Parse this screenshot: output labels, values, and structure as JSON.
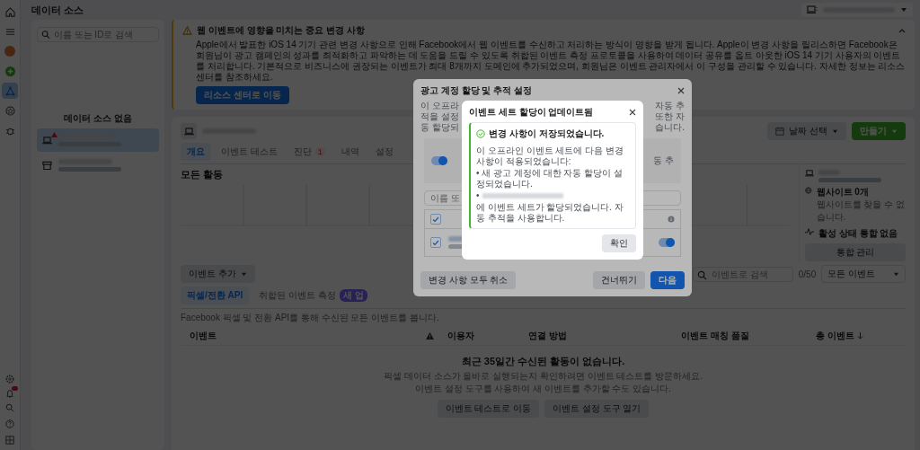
{
  "header": {
    "title": "데이터 소스"
  },
  "rail": {
    "items": [
      {
        "kind": "home",
        "selected": false
      },
      {
        "kind": "menu",
        "selected": false
      },
      {
        "kind": "avatar",
        "selected": false
      },
      {
        "kind": "add",
        "selected": false
      },
      {
        "kind": "network",
        "selected": true
      },
      {
        "kind": "star",
        "selected": false
      },
      {
        "kind": "bug",
        "selected": false
      }
    ],
    "bell_badge": true
  },
  "sidebar": {
    "search_placeholder": "이름 또는 ID로 검색",
    "empty_label": "데이터 소스 없음",
    "items": [
      {
        "kind": "laptop",
        "selected": true,
        "warning": true
      },
      {
        "kind": "store",
        "selected": false,
        "warning": false
      }
    ]
  },
  "banner": {
    "title": "웹 이벤트에 영향을 미치는 중요 변경 사항",
    "body": "Apple에서 발표한 iOS 14 기기 관련 변경 사항으로 인해 Facebook에서 웹 이벤트를 수신하고 처리하는 방식이 영향을 받게 됩니다. Apple이 변경 사항을 릴리스하면 Facebook은 회원님이 광고 캠페인의 성과를 최적화하고 파악하는 데 도움을 드릴 수 있도록 취합된 이벤트 측정 프로토콜을 사용하여 데이터 공유를 옵트 아웃한 iOS 14 기기 사용자의 이벤트를 처리합니다. 기본적으로 비즈니스에 권장되는 이벤트가 최대 8개까지 도메인에 추가되었으며, 회원님은 이벤트 관리자에서 이 구성을 관리할 수 있습니다. 자세한 정보는 리소스 센터를 참조하세요.",
    "button": "리소스 센터로 이동"
  },
  "card": {
    "tabs": [
      {
        "label": "개요",
        "selected": true
      },
      {
        "label": "이벤트 테스트",
        "selected": false
      },
      {
        "label": "진단",
        "selected": false,
        "badge": "1"
      },
      {
        "label": "내역",
        "selected": false
      },
      {
        "label": "설정",
        "selected": false
      }
    ],
    "date_button": "날짜 선택",
    "create_button": "만들기",
    "section_title": "모든 활동",
    "side": {
      "websites_title": "웹사이트 0개",
      "websites_text": "웹사이트를 찾을 수 없습니다.",
      "integration": "활성 상태 통합 없음",
      "manage_button": "통합 관리"
    },
    "add_event_button": "이벤트 추가",
    "event_search": {
      "placeholder": "이벤트로 검색",
      "count": "0/50"
    },
    "event_filter": "모든 이벤트",
    "subtabs": [
      {
        "label": "픽셀/전환 API",
        "selected": true
      },
      {
        "label": "취합된 이벤트 측정",
        "selected": false,
        "badge": "새 업"
      }
    ],
    "description": "Facebook 픽셀 및 전환 API를 통해 수신된 모든 이벤트를 봅니다.",
    "columns": [
      {
        "kind": "text",
        "label": "이벤트"
      },
      {
        "kind": "warning"
      },
      {
        "kind": "text",
        "label": "이용자"
      },
      {
        "kind": "text",
        "label": "연결 방법"
      },
      {
        "kind": "text",
        "label": "이벤트 매칭 품질"
      },
      {
        "kind": "sorted",
        "label": "총 이벤트"
      }
    ],
    "empty": {
      "title": "최근 35일간 수신된 활동이 없습니다.",
      "lines": [
        "픽셀 데이터 소스가 올바로 실행되는지 확인하려면 이벤트 테스트를 방문하세요.",
        "이벤트 설정 도구를 사용하여 새 이벤트를 추가할 수도 있습니다."
      ],
      "buttons": [
        "이벤트 테스트로 이동",
        "이벤트 설정 도구 열기"
      ]
    }
  },
  "back_modal": {
    "title": "광고 계정 할당 및 추적 설정",
    "intro": [
      {
        "left": "이 오프라",
        "right": "자동 추"
      },
      {
        "left": "적을 설정",
        "right": "또한 자"
      },
      {
        "left": "동 할당되",
        "right": "습니다."
      }
    ],
    "option": {
      "on": true,
      "text": "동 추"
    },
    "search_placeholder": "이름 또",
    "header_checked": true,
    "rows": [
      {
        "checked": true,
        "on": true
      }
    ],
    "buttons": {
      "cancel": "변경 사항 모두 취소",
      "skip": "건너뛰기",
      "next": "다음"
    }
  },
  "front_modal": {
    "title": "이벤트 세트 할당이 업데이트됨",
    "success": "변경 사항이 저장되었습니다.",
    "intro": "이 오프라인 이벤트 세트에 다음 변경 사항이 적용되었습니다:",
    "bullets": [
      "• 새 광고 계정에 대한 자동 할당이 설정되었습니다.",
      "에 이벤트 세트가 할당되었습니다. 자동 추적을 사용합니다."
    ],
    "bullet_mark": "•",
    "button": "확인"
  }
}
